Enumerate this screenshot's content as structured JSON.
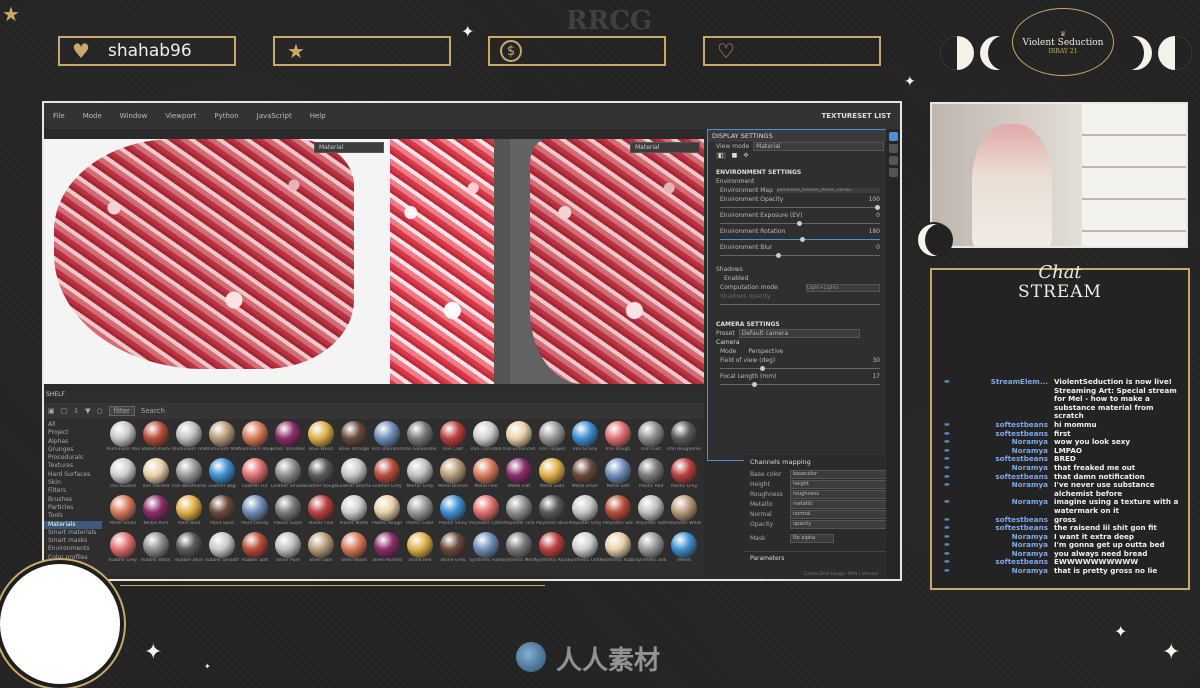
{
  "watermarks": {
    "top": "RRCG",
    "bottom_cn": "人人素材",
    "bottom_small": "RRCG"
  },
  "alerts": [
    {
      "icon": "heart-icon",
      "glyph": "♥",
      "text": "shahab96"
    },
    {
      "icon": "star-icon",
      "glyph": "★",
      "text": ""
    },
    {
      "icon": "dollar-icon",
      "glyph": "$",
      "text": ""
    },
    {
      "icon": "hand-heart-icon",
      "glyph": "♡",
      "text": ""
    }
  ],
  "logo": {
    "line1": "Violent Seduction",
    "line2": "IRRAY 21"
  },
  "app": {
    "menu": [
      "File",
      "Mode",
      "Window",
      "Viewport",
      "Python",
      "JavaScript",
      "Help"
    ],
    "texture_set_list": "TEXTURESET LIST",
    "viewport_left_label": "Material",
    "viewport_right_label": "Material",
    "shelf_title": "SHELF",
    "shelf_search": "filter",
    "shelf_search2": "Search",
    "categories": [
      "All",
      "Project",
      "Alphas",
      "Grunges",
      "Procedurals",
      "Textures",
      "Hard Surfaces",
      "Skin",
      "Filters",
      "Brushes",
      "Particles",
      "Tools",
      "Materials",
      "Smart materials",
      "Smart masks",
      "Environments",
      "Color profiles"
    ],
    "selected_category": "Materials",
    "materials": [
      [
        "Aluminium Roug",
        "Baked Alumi",
        "Aluminium Fine",
        "Aluminium Mat",
        "Aluminum Roug",
        "Brass Tarnished",
        "Blue Wood",
        "Bone Strange",
        "Iron Diamond",
        "Iron Galvanized",
        "Iron Cast",
        "Iron Corroded",
        "Iron Enhanced",
        "Iron Forged",
        "Iron Grainy",
        "Iron Rough",
        "Iron Rust",
        "Iron Roughened"
      ],
      [
        "Iron Rusted",
        "Iron Painted",
        "Iron Weathered",
        "Leather Bag",
        "Leather Fur",
        "Leather Smooth",
        "Leather Rough",
        "Leather Stitched",
        "Leather Grey",
        "Mortar Grey",
        "Metal Bronze",
        "Metal Fine",
        "Metal Flat",
        "Metal Gold",
        "Metal Silver",
        "Metal Soft",
        "Plastic Red",
        "Plastic Grey"
      ],
      [
        "Mesh Small",
        "Nickel Pure",
        "Paint Blue",
        "Paint Solid",
        "Paint Glossy",
        "Plastic Gloss",
        "Plastic Fine",
        "Plastic Matte",
        "Plastic Rough",
        "Plastic Color",
        "Plastic Shiny",
        "Polyester Cotton",
        "Polyester Fine",
        "Polyester Blue",
        "Polyester Grey",
        "Polyester Silk",
        "Polyester Soft",
        "Polyester White"
      ],
      [
        "Rubber Grey",
        "Rubber Black",
        "Rubber Blue",
        "Rubber Smooth",
        "Rubber Soft",
        "Silver Pure",
        "Steel Dark",
        "Steel Wood",
        "Steel Painted",
        "Stone Red",
        "Stone Grey",
        "Synthetic Fiber",
        "Synthetic Mesh",
        "Synthetic Round",
        "Synthetic Cloth",
        "Synthetic Rubber",
        "Synthetic Silk",
        "Velvet"
      ]
    ],
    "display_settings": {
      "title": "DISPLAY SETTINGS",
      "view_mode_label": "View mode",
      "view_mode": "Material",
      "env_section": "ENVIRONMENT SETTINGS",
      "env_label": "Environment",
      "envmap_label": "Environment Map",
      "envmap_value": "panorama_tomoco_ttorre_vanilla",
      "opacity_label": "Environment Opacity",
      "opacity_value": "100",
      "exposure_label": "Environment Exposure (EV)",
      "exposure_value": "0",
      "rotation_label": "Environment Rotation",
      "rotation_value": "180",
      "blur_label": "Environment Blur",
      "blur_value": "0",
      "shadows_label": "Shadows",
      "shadows_enabled": "Enabled",
      "computation_label": "Computation mode",
      "computation_value": "Light+Lights",
      "shadow_opacity": "Shadows opacity",
      "camera_section": "CAMERA SETTINGS",
      "preset_label": "Preset",
      "preset_value": "Default camera",
      "camera_label": "Camera",
      "mode_label": "Mode",
      "mode_value": "Perspective",
      "fov_label": "Field of view (deg)",
      "fov_value": "30",
      "focal_label": "Focal Length (mm)",
      "focal_value": "17"
    },
    "props": {
      "title": "Channels mapping",
      "rows": [
        [
          "Base color",
          "basecolor"
        ],
        [
          "Height",
          "height"
        ],
        [
          "Roughness",
          "roughness"
        ],
        [
          "Metallic",
          "metallic"
        ],
        [
          "Normal",
          "normal"
        ],
        [
          "Opacity",
          "opacity"
        ]
      ],
      "mask_label": "Mask",
      "mask_value": "No alpha",
      "params": "Parameters"
    },
    "status": "Cache Disk Usage: 90% | Version"
  },
  "chat": {
    "title1": "Chat",
    "title2": "STREAM",
    "messages": [
      {
        "user": "StreamElem...",
        "text": "ViolentSeduction is now live! Streaming Art: Special stream for Mel - how to make a substance material from scratch"
      },
      {
        "user": "softestbeans",
        "text": "hi mommu"
      },
      {
        "user": "softestbeans",
        "text": "first"
      },
      {
        "user": "Noramya",
        "text": "wow you look sexy"
      },
      {
        "user": "Noramya",
        "text": "LMPAO"
      },
      {
        "user": "softestbeans",
        "text": "BRED"
      },
      {
        "user": "Noramya",
        "text": "that freaked me out"
      },
      {
        "user": "softestbeans",
        "text": "that damn notification"
      },
      {
        "user": "Noramya",
        "text": "I've never use substance alchemist before"
      },
      {
        "user": "Noramya",
        "text": "imagine using a texture with a watermark on it"
      },
      {
        "user": "softestbeans",
        "text": "gross"
      },
      {
        "user": "softestbeans",
        "text": "the raisend lil shit gon fit"
      },
      {
        "user": "Noramya",
        "text": "I want it extra deep"
      },
      {
        "user": "Noramya",
        "text": "I'm gonna get up outta bed"
      },
      {
        "user": "Noramya",
        "text": "you always need bread"
      },
      {
        "user": "softestbeans",
        "text": "EWWWWWWWWWW"
      },
      {
        "user": "Noramya",
        "text": "that is pretty gross no lie"
      }
    ]
  },
  "colors": {
    "gold": "#c9a96a",
    "panel_border": "#4d8fd1",
    "chat_user": "#7fa9e6"
  }
}
